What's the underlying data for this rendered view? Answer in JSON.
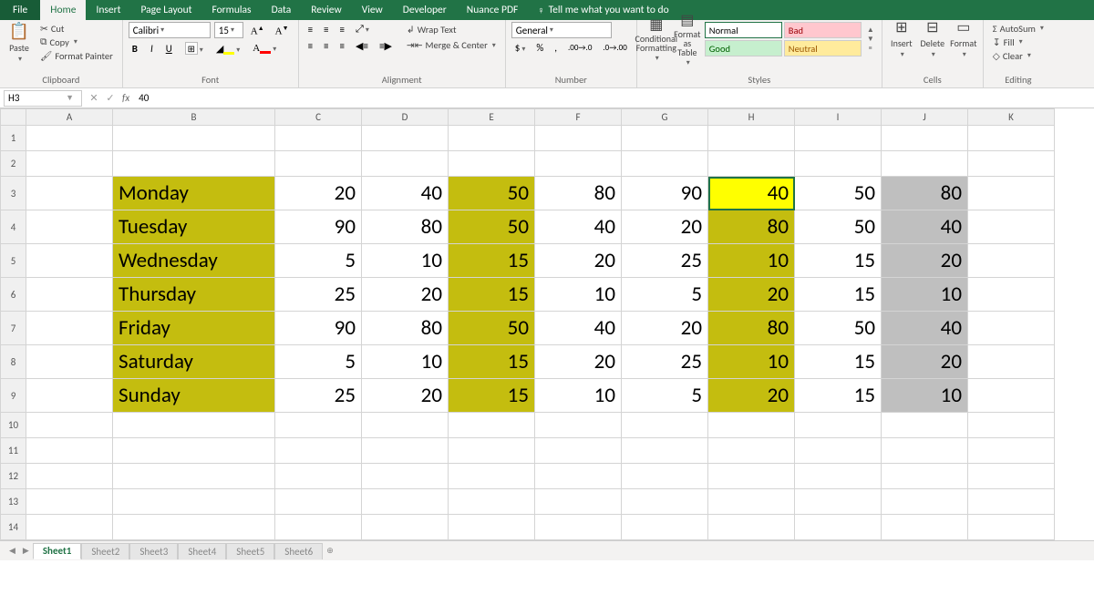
{
  "tabs": {
    "file": "File",
    "list": [
      "Home",
      "Insert",
      "Page Layout",
      "Formulas",
      "Data",
      "Review",
      "View",
      "Developer",
      "Nuance PDF"
    ],
    "active": "Home",
    "tellme": "Tell me what you want to do"
  },
  "clipboard": {
    "paste": "Paste",
    "cut": "Cut",
    "copy": "Copy",
    "format_painter": "Format Painter",
    "group": "Clipboard"
  },
  "font": {
    "name": "Calibri",
    "size": "15",
    "group": "Font"
  },
  "alignment": {
    "wrap": "Wrap Text",
    "merge": "Merge & Center",
    "group": "Alignment"
  },
  "number": {
    "format": "General",
    "group": "Number"
  },
  "styles": {
    "cond": "Conditional Formatting",
    "table": "Format as Table",
    "normal": "Normal",
    "bad": "Bad",
    "good": "Good",
    "neutral": "Neutral",
    "group": "Styles"
  },
  "cells": {
    "insert": "Insert",
    "delete": "Delete",
    "format": "Format",
    "group": "Cells"
  },
  "editing": {
    "autosum": "AutoSum",
    "fill": "Fill",
    "clear": "Clear",
    "group": "Editing"
  },
  "formula_bar": {
    "name_box": "H3",
    "value": "40"
  },
  "columns": [
    "A",
    "B",
    "C",
    "D",
    "E",
    "F",
    "G",
    "H",
    "I",
    "J",
    "K"
  ],
  "rows": {
    "visible": [
      1,
      2,
      3,
      4,
      5,
      6,
      7,
      8,
      9,
      10,
      11,
      12,
      13,
      14
    ],
    "data": [
      {
        "r": 3,
        "day": "Monday",
        "c": 20,
        "d": 40,
        "e": 50,
        "f": 80,
        "g": 90,
        "h": 40,
        "i": 50,
        "j": 80
      },
      {
        "r": 4,
        "day": "Tuesday",
        "c": 90,
        "d": 80,
        "e": 50,
        "f": 40,
        "g": 20,
        "h": 80,
        "i": 50,
        "j": 40
      },
      {
        "r": 5,
        "day": "Wednesday",
        "c": 5,
        "d": 10,
        "e": 15,
        "f": 20,
        "g": 25,
        "h": 10,
        "i": 15,
        "j": 20
      },
      {
        "r": 6,
        "day": "Thursday",
        "c": 25,
        "d": 20,
        "e": 15,
        "f": 10,
        "g": 5,
        "h": 20,
        "i": 15,
        "j": 10
      },
      {
        "r": 7,
        "day": "Friday",
        "c": 90,
        "d": 80,
        "e": 50,
        "f": 40,
        "g": 20,
        "h": 80,
        "i": 50,
        "j": 40
      },
      {
        "r": 8,
        "day": "Saturday",
        "c": 5,
        "d": 10,
        "e": 15,
        "f": 20,
        "g": 25,
        "h": 10,
        "i": 15,
        "j": 20
      },
      {
        "r": 9,
        "day": "Sunday",
        "c": 25,
        "d": 20,
        "e": 15,
        "f": 10,
        "g": 5,
        "h": 20,
        "i": 15,
        "j": 10
      }
    ]
  },
  "sheet_tabs": [
    "Sheet1",
    "Sheet2",
    "Sheet3",
    "Sheet4",
    "Sheet5",
    "Sheet6"
  ],
  "active_cell": "H3"
}
